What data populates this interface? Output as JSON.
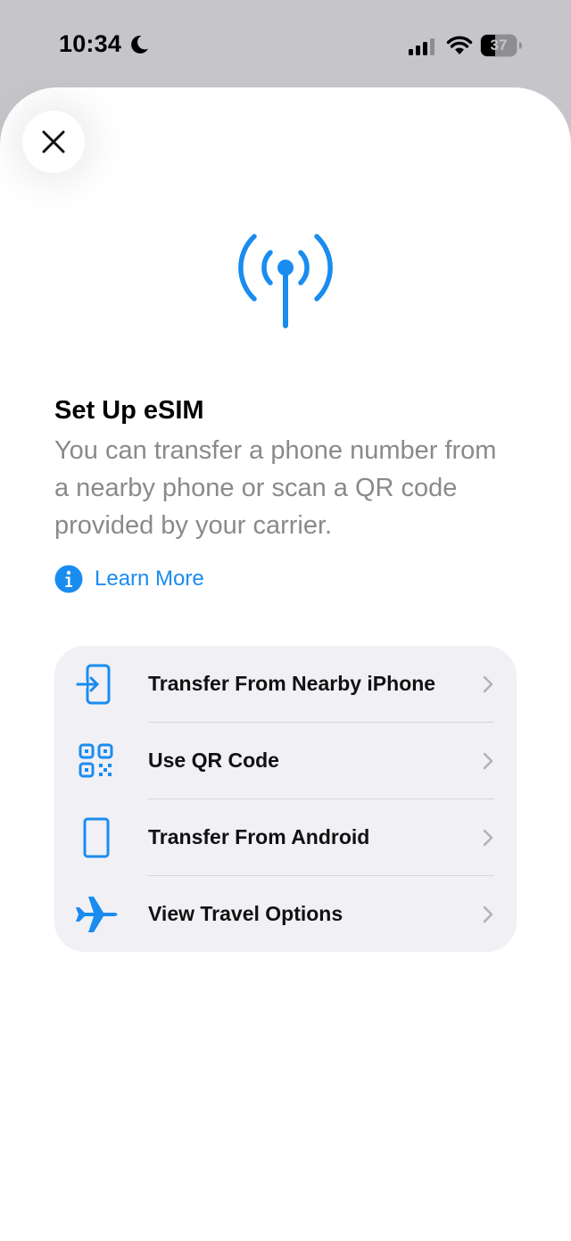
{
  "status": {
    "time": "10:34",
    "battery": "37",
    "icons": [
      "moon-icon",
      "cellular-signal-icon",
      "wifi-icon",
      "battery-icon"
    ]
  },
  "sheet": {
    "close_icon": "close-icon",
    "hero_icon": "antenna-broadcast-icon",
    "title": "Set Up eSIM",
    "description": "You can transfer a phone number from a nearby phone or scan a QR code provided by your carrier.",
    "learn_more": "Learn More"
  },
  "options": [
    {
      "label": "Transfer From Nearby iPhone",
      "icon": "transfer-phone-icon"
    },
    {
      "label": "Use QR Code",
      "icon": "qr-code-icon"
    },
    {
      "label": "Transfer From Android",
      "icon": "android-phone-icon"
    },
    {
      "label": "View Travel Options",
      "icon": "airplane-icon"
    }
  ],
  "colors": {
    "accent": "#1a8cf0",
    "background_dim": "#c6c6ca",
    "card": "#f0f0f5",
    "secondary_text": "#8a8a8e"
  }
}
